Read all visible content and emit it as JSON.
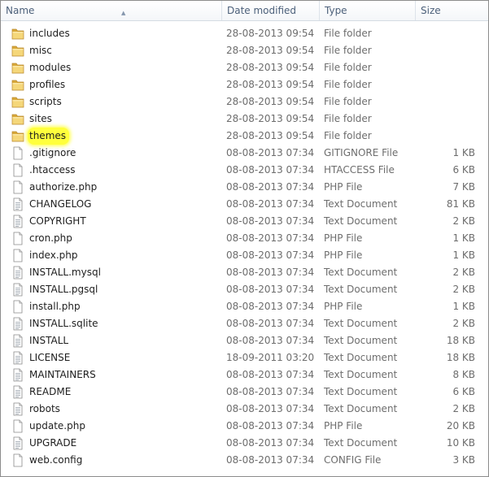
{
  "columns": {
    "name": "Name",
    "date": "Date modified",
    "type": "Type",
    "size": "Size"
  },
  "icons": {
    "folder": "folder-icon",
    "file": "file-icon",
    "document": "document-icon"
  },
  "colors": {
    "header_text": "#4c607a",
    "highlight": "#ffff3c",
    "folder_light": "#f5d77a",
    "folder_dark": "#d9a93a"
  },
  "files": [
    {
      "name": "includes",
      "date": "28-08-2013 09:54",
      "type": "File folder",
      "size": "",
      "icon": "folder"
    },
    {
      "name": "misc",
      "date": "28-08-2013 09:54",
      "type": "File folder",
      "size": "",
      "icon": "folder"
    },
    {
      "name": "modules",
      "date": "28-08-2013 09:54",
      "type": "File folder",
      "size": "",
      "icon": "folder"
    },
    {
      "name": "profiles",
      "date": "28-08-2013 09:54",
      "type": "File folder",
      "size": "",
      "icon": "folder"
    },
    {
      "name": "scripts",
      "date": "28-08-2013 09:54",
      "type": "File folder",
      "size": "",
      "icon": "folder"
    },
    {
      "name": "sites",
      "date": "28-08-2013 09:54",
      "type": "File folder",
      "size": "",
      "icon": "folder"
    },
    {
      "name": "themes",
      "date": "28-08-2013 09:54",
      "type": "File folder",
      "size": "",
      "icon": "folder",
      "highlighted": true
    },
    {
      "name": ".gitignore",
      "date": "08-08-2013 07:34",
      "type": "GITIGNORE File",
      "size": "1 KB",
      "icon": "file"
    },
    {
      "name": ".htaccess",
      "date": "08-08-2013 07:34",
      "type": "HTACCESS File",
      "size": "6 KB",
      "icon": "file"
    },
    {
      "name": "authorize.php",
      "date": "08-08-2013 07:34",
      "type": "PHP File",
      "size": "7 KB",
      "icon": "file"
    },
    {
      "name": "CHANGELOG",
      "date": "08-08-2013 07:34",
      "type": "Text Document",
      "size": "81 KB",
      "icon": "document"
    },
    {
      "name": "COPYRIGHT",
      "date": "08-08-2013 07:34",
      "type": "Text Document",
      "size": "2 KB",
      "icon": "document"
    },
    {
      "name": "cron.php",
      "date": "08-08-2013 07:34",
      "type": "PHP File",
      "size": "1 KB",
      "icon": "file"
    },
    {
      "name": "index.php",
      "date": "08-08-2013 07:34",
      "type": "PHP File",
      "size": "1 KB",
      "icon": "file"
    },
    {
      "name": "INSTALL.mysql",
      "date": "08-08-2013 07:34",
      "type": "Text Document",
      "size": "2 KB",
      "icon": "document"
    },
    {
      "name": "INSTALL.pgsql",
      "date": "08-08-2013 07:34",
      "type": "Text Document",
      "size": "2 KB",
      "icon": "document"
    },
    {
      "name": "install.php",
      "date": "08-08-2013 07:34",
      "type": "PHP File",
      "size": "1 KB",
      "icon": "file"
    },
    {
      "name": "INSTALL.sqlite",
      "date": "08-08-2013 07:34",
      "type": "Text Document",
      "size": "2 KB",
      "icon": "document"
    },
    {
      "name": "INSTALL",
      "date": "08-08-2013 07:34",
      "type": "Text Document",
      "size": "18 KB",
      "icon": "document"
    },
    {
      "name": "LICENSE",
      "date": "18-09-2011 03:20",
      "type": "Text Document",
      "size": "18 KB",
      "icon": "document"
    },
    {
      "name": "MAINTAINERS",
      "date": "08-08-2013 07:34",
      "type": "Text Document",
      "size": "8 KB",
      "icon": "document"
    },
    {
      "name": "README",
      "date": "08-08-2013 07:34",
      "type": "Text Document",
      "size": "6 KB",
      "icon": "document"
    },
    {
      "name": "robots",
      "date": "08-08-2013 07:34",
      "type": "Text Document",
      "size": "2 KB",
      "icon": "document"
    },
    {
      "name": "update.php",
      "date": "08-08-2013 07:34",
      "type": "PHP File",
      "size": "20 KB",
      "icon": "file"
    },
    {
      "name": "UPGRADE",
      "date": "08-08-2013 07:34",
      "type": "Text Document",
      "size": "10 KB",
      "icon": "document"
    },
    {
      "name": "web.config",
      "date": "08-08-2013 07:34",
      "type": "CONFIG File",
      "size": "3 KB",
      "icon": "file"
    }
  ]
}
